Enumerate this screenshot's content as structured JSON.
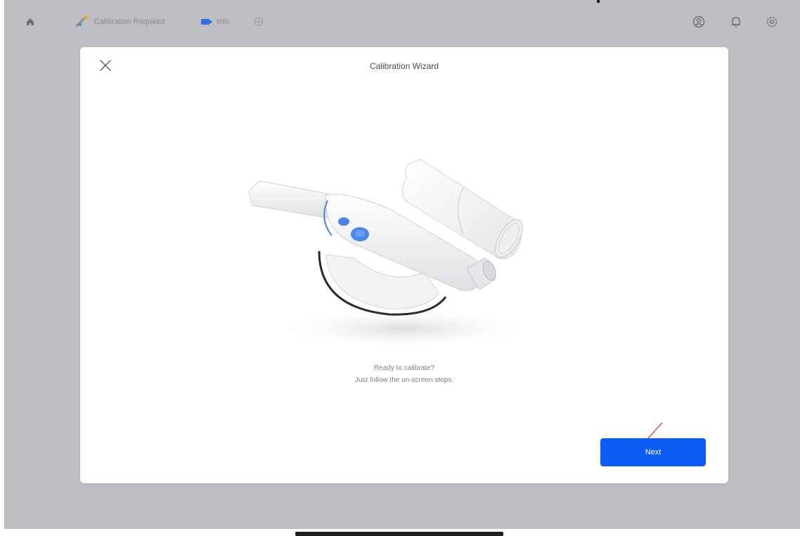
{
  "status_bar": {
    "calibration_status": "Calibration Required",
    "wifi_label": "Info"
  },
  "icons": {
    "home": "home-icon",
    "scanner_status": "scanner-icon",
    "wifi": "wifi-icon",
    "extra": "info-icon",
    "user": "user-icon",
    "notifications": "bell-icon",
    "settings": "gear-icon",
    "close": "close-icon"
  },
  "modal": {
    "title": "Calibration Wizard",
    "message_line1": "Ready to calibrate?",
    "message_line2": "Just follow the on-screen steps.",
    "next_label": "Next"
  },
  "colors": {
    "background": "#bdbec1",
    "accent": "#0b5cf5",
    "scanner_button": "#4a86e8"
  }
}
